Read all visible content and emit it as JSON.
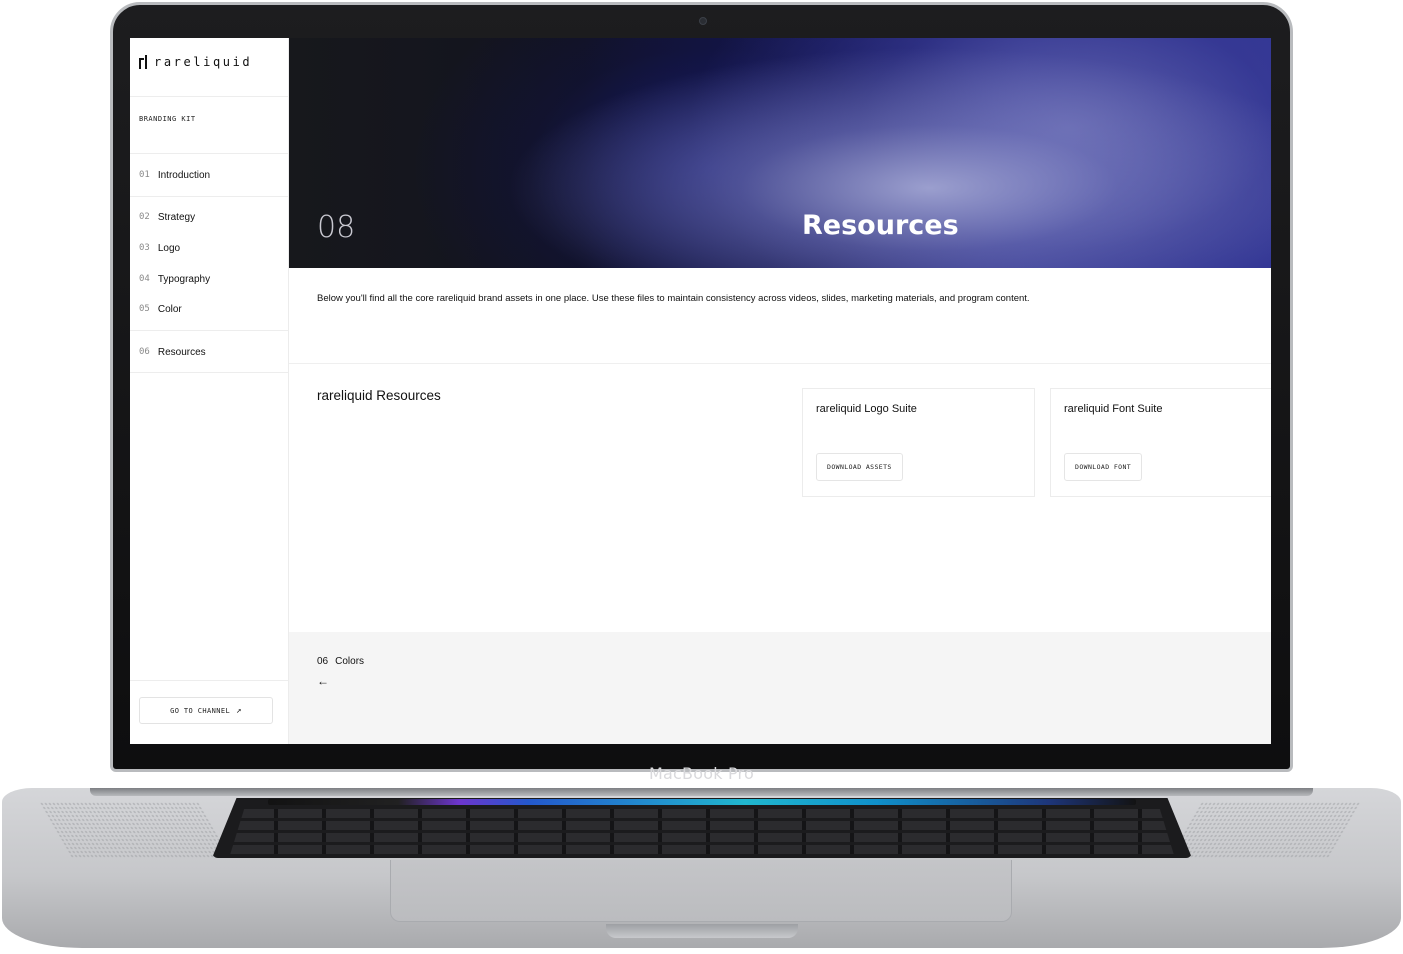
{
  "device": {
    "label": "MacBook Pro"
  },
  "sidebar": {
    "logo_text": "rareliquid",
    "kit_label": "BRANDING KIT",
    "items": [
      {
        "num": "01",
        "label": "Introduction"
      },
      {
        "num": "02",
        "label": "Strategy"
      },
      {
        "num": "03",
        "label": "Logo"
      },
      {
        "num": "04",
        "label": "Typography"
      },
      {
        "num": "05",
        "label": "Color"
      },
      {
        "num": "06",
        "label": "Resources"
      }
    ],
    "channel_button": "GO TO CHANNEL",
    "channel_icon": "↗"
  },
  "hero": {
    "number": "08",
    "title": "Resources"
  },
  "intro": "Below you'll find all the core rareliquid brand assets in one place. Use these files to maintain consistency across videos, slides, marketing materials, and program content.",
  "resources": {
    "heading": "rareliquid Resources",
    "cards": [
      {
        "title": "rareliquid Logo Suite",
        "button": "DOWNLOAD ASSETS"
      },
      {
        "title": "rareliquid Font Suite",
        "button": "DOWNLOAD FONT"
      }
    ]
  },
  "footer": {
    "prev_num": "06",
    "prev_label": "Colors",
    "prev_arrow": "←"
  },
  "colors": {
    "accent_blue": "#2a2e8a",
    "text": "#111111",
    "footer_bg": "#f5f5f5"
  }
}
